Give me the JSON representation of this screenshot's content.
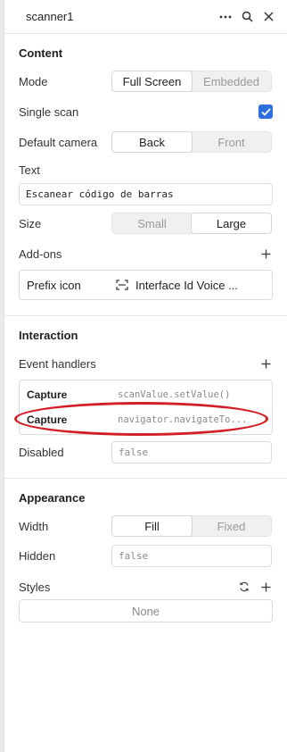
{
  "header": {
    "title": "scanner1",
    "icons": [
      "more-icon",
      "search-icon",
      "close-icon"
    ]
  },
  "content": {
    "title": "Content",
    "mode": {
      "label": "Mode",
      "options": [
        "Full Screen",
        "Embedded"
      ],
      "selected": "Full Screen"
    },
    "single_scan": {
      "label": "Single scan",
      "checked": true
    },
    "default_camera": {
      "label": "Default camera",
      "options": [
        "Back",
        "Front"
      ],
      "selected": "Back"
    },
    "text": {
      "label": "Text",
      "value": "Escanear código de barras"
    },
    "size": {
      "label": "Size",
      "options": [
        "Small",
        "Large"
      ],
      "selected": "Large"
    },
    "addons": {
      "label": "Add-ons",
      "prefix_label": "Prefix icon",
      "prefix_value": "Interface Id Voice ..."
    }
  },
  "interaction": {
    "title": "Interaction",
    "event_handlers_label": "Event handlers",
    "handlers": [
      {
        "event": "Capture",
        "code": "scanValue.setValue()"
      },
      {
        "event": "Capture",
        "code": "navigator.navigateTo..."
      }
    ],
    "disabled": {
      "label": "Disabled",
      "value": "false"
    }
  },
  "appearance": {
    "title": "Appearance",
    "width": {
      "label": "Width",
      "options": [
        "Fill",
        "Fixed"
      ],
      "selected": "Fill"
    },
    "hidden": {
      "label": "Hidden",
      "value": "false"
    },
    "styles": {
      "label": "Styles",
      "value": "None"
    }
  },
  "colors": {
    "accent": "#2e6fe0",
    "highlight": "#d21e25"
  }
}
